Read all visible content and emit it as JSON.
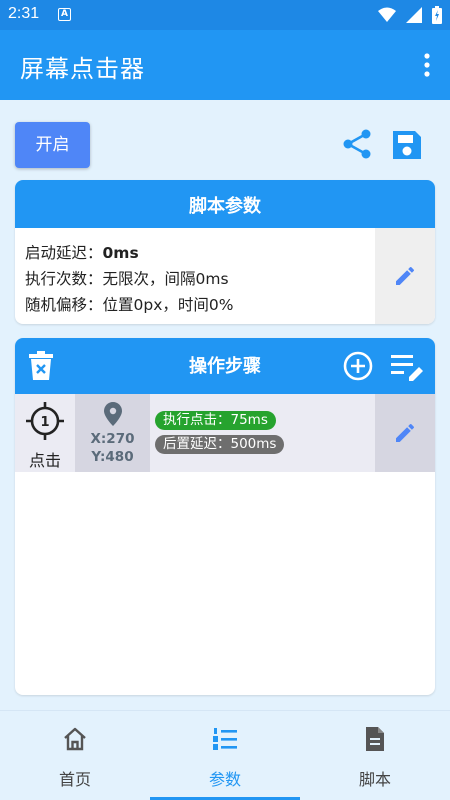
{
  "status_bar": {
    "time": "2:31",
    "notif_letter": "A"
  },
  "app_bar": {
    "title": "屏幕点击器"
  },
  "toolbar": {
    "start_label": "开启"
  },
  "params_card": {
    "title": "脚本参数",
    "lines": [
      {
        "label": "启动延迟：",
        "value": "0ms"
      },
      {
        "label": "执行次数：",
        "value": "无限次，间隔0ms"
      },
      {
        "label": "随机偏移：",
        "value": "位置0px，时间0%"
      }
    ]
  },
  "steps_card": {
    "title": "操作步骤",
    "steps": [
      {
        "index": "1",
        "type_label": "点击",
        "x": "X:270",
        "y": "Y:480",
        "exec_tag": "执行点击：75ms",
        "delay_tag": "后置延迟：500ms"
      }
    ]
  },
  "bottom_nav": {
    "items": [
      {
        "label": "首页",
        "icon": "home-icon"
      },
      {
        "label": "参数",
        "icon": "list-numbered-icon",
        "active": true
      },
      {
        "label": "脚本",
        "icon": "document-icon"
      }
    ]
  },
  "colors": {
    "primary": "#2196f3",
    "status_bar": "#1e88e5",
    "button": "#4f86f7",
    "tag_green": "#26a32e",
    "tag_gray": "#6e6e6e",
    "background": "#e3f2fd"
  }
}
